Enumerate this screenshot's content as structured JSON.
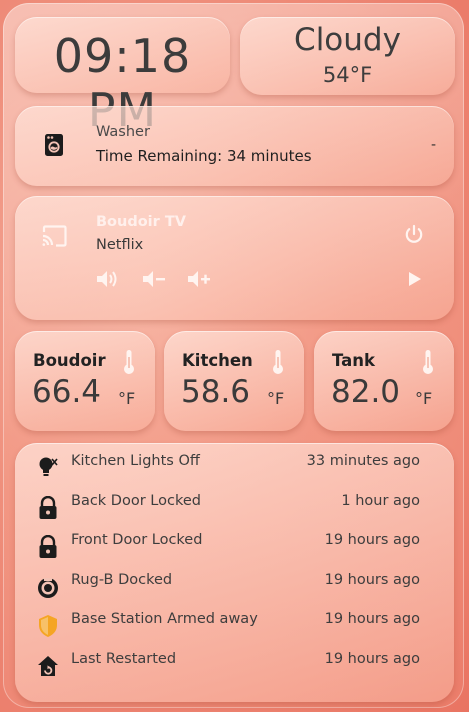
{
  "clock": {
    "time": "09:18 PM"
  },
  "weather": {
    "condition": "Cloudy",
    "temperature": "54°F"
  },
  "washer": {
    "name": "Washer",
    "status": "Time Remaining: 34 minutes",
    "value": "-",
    "icon": "washing-machine-icon"
  },
  "media": {
    "title": "Boudoir TV",
    "app": "Netflix",
    "icons": [
      "cast-icon",
      "power-icon",
      "volume-mute-icon",
      "volume-down-icon",
      "volume-up-icon",
      "play-icon"
    ]
  },
  "sensors": [
    {
      "name": "Boudoir",
      "value": "66.4",
      "unit": "°F",
      "icon": "thermometer-icon"
    },
    {
      "name": "Kitchen",
      "value": "58.6",
      "unit": "°F",
      "icon": "thermometer-icon"
    },
    {
      "name": "Tank",
      "value": "82.0",
      "unit": "°F",
      "icon": "thermometer-icon"
    }
  ],
  "logbook": [
    {
      "text": "Kitchen Lights Off",
      "time": "33 minutes ago",
      "icon": "lightbulb-icon"
    },
    {
      "text": "Back Door Locked",
      "time": "1 hour ago",
      "icon": "lock-icon"
    },
    {
      "text": "Front Door Locked",
      "time": "19 hours ago",
      "icon": "lock-icon"
    },
    {
      "text": "Rug-B Docked",
      "time": "19 hours ago",
      "icon": "robot-vacuum-icon"
    },
    {
      "text": "Base Station Armed away",
      "time": "19 hours ago",
      "icon": "shield-icon"
    },
    {
      "text": "Last Restarted",
      "time": "19 hours ago",
      "icon": "home-restart-icon"
    }
  ],
  "colors": {
    "accent_text": "#fff0ec",
    "shield": "#f5a524",
    "icon_light": "#fff4f0",
    "icon_dark": "#1c1c1c"
  }
}
